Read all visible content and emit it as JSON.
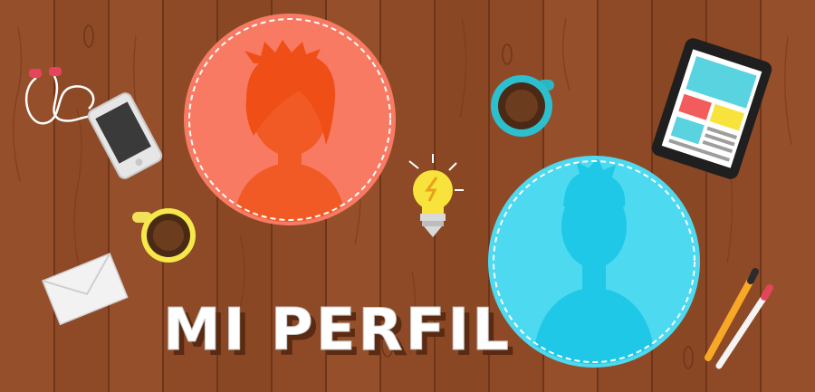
{
  "banner": {
    "title": "MI PERFIL"
  },
  "colors": {
    "wood_base": "#8e4a27",
    "wood_light": "#a45a30",
    "wood_dark": "#6e3519",
    "avatar_female_circle": "#f97a63",
    "avatar_female_silhouette": "#f15a24",
    "avatar_male_circle": "#4dd9f0",
    "avatar_male_silhouette": "#1ec8e6",
    "title_fill": "#ffffff",
    "title_shade": "#5a2a12"
  },
  "objects": [
    {
      "name": "female-avatar-icon"
    },
    {
      "name": "male-avatar-icon"
    },
    {
      "name": "lightbulb-icon"
    },
    {
      "name": "coffee-cup-icon"
    },
    {
      "name": "tablet-icon"
    },
    {
      "name": "smartphone-icon"
    },
    {
      "name": "earphones-icon"
    },
    {
      "name": "envelope-icon"
    },
    {
      "name": "pens-icon"
    }
  ]
}
